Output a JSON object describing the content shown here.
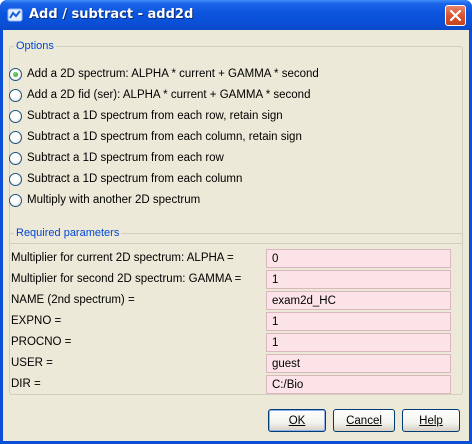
{
  "window": {
    "title": "Add / subtract - add2d",
    "title_bar_color": "#0a4fd6",
    "close_icon": "close-icon",
    "app_icon": "app-icon"
  },
  "options": {
    "legend": "Options",
    "selected_index": 0,
    "items": [
      {
        "label": "Add a 2D spectrum: ALPHA * current + GAMMA * second",
        "checked": true
      },
      {
        "label": "Add a 2D fid (ser): ALPHA * current + GAMMA * second",
        "checked": false
      },
      {
        "label": "Subtract a 1D spectrum from each row, retain sign",
        "checked": false
      },
      {
        "label": "Subtract a 1D spectrum from each column, retain sign",
        "checked": false
      },
      {
        "label": "Subtract a 1D spectrum from each row",
        "checked": false
      },
      {
        "label": "Subtract a 1D spectrum from each column",
        "checked": false
      },
      {
        "label": "Multiply with another 2D spectrum",
        "checked": false
      }
    ]
  },
  "params": {
    "legend": "Required parameters",
    "input_background": "#fbe3e7",
    "rows": [
      {
        "label": "Multiplier for current 2D spectrum: ALPHA =",
        "value": "0"
      },
      {
        "label": "Multiplier for second 2D spectrum: GAMMA =",
        "value": "1"
      },
      {
        "label": "NAME (2nd spectrum) =",
        "value": "exam2d_HC"
      },
      {
        "label": "EXPNO =",
        "value": "1"
      },
      {
        "label": "PROCNO =",
        "value": "1"
      },
      {
        "label": "USER =",
        "value": "guest"
      },
      {
        "label": "DIR =",
        "value": "C:/Bio"
      }
    ]
  },
  "buttons": {
    "ok_label": "OK",
    "cancel_label": "Cancel",
    "help_label": "Help"
  }
}
